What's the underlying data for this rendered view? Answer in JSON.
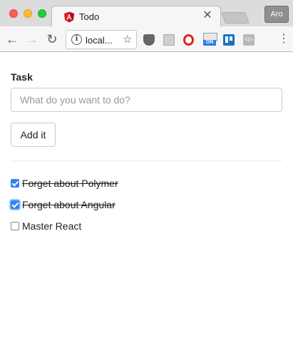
{
  "window": {
    "tab_title": "Todo",
    "profile_label": "Aro"
  },
  "toolbar": {
    "url": "local...",
    "extensions": [
      "pocket-icon",
      "extension-icon",
      "opera-icon",
      "on-extension-icon",
      "trello-icon",
      "code-extension-icon"
    ]
  },
  "form": {
    "label": "Task",
    "placeholder": "What do you want to do?",
    "value": "",
    "submit_label": "Add it"
  },
  "todos": [
    {
      "text": "Forget about Polymer",
      "done": true,
      "focused": false
    },
    {
      "text": "Forget about Angular",
      "done": true,
      "focused": true
    },
    {
      "text": "Master React",
      "done": false,
      "focused": false
    }
  ],
  "colors": {
    "accent": "#2f83f7",
    "angular_red": "#dd1b16"
  }
}
